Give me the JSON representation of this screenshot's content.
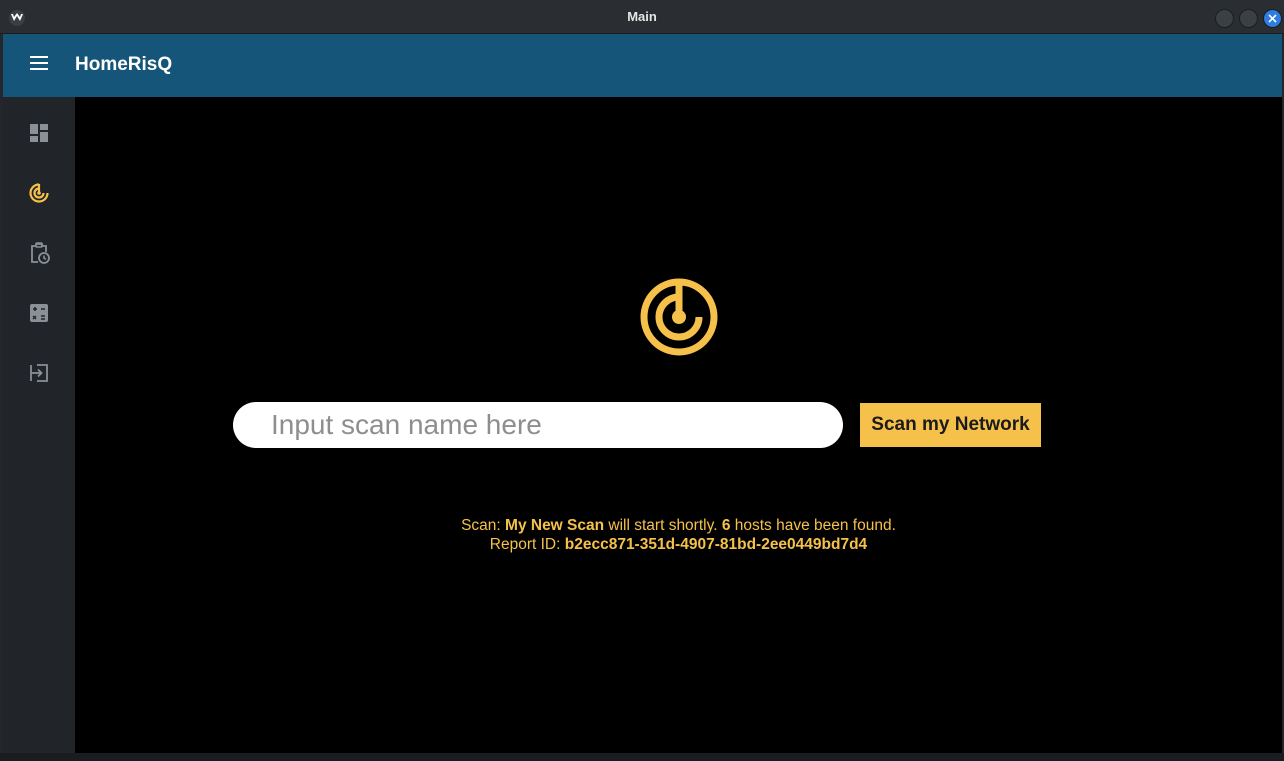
{
  "window": {
    "title": "Main"
  },
  "appbar": {
    "title": "HomeRisQ",
    "menu_icon": "hamburger-menu-icon"
  },
  "rail": {
    "items": [
      {
        "icon": "dashboard-icon",
        "active": false
      },
      {
        "icon": "radar-scan-icon",
        "active": true
      },
      {
        "icon": "clipboard-clock-icon",
        "active": false
      },
      {
        "icon": "calculator-icon",
        "active": false
      },
      {
        "icon": "logout-icon",
        "active": false
      }
    ]
  },
  "scan": {
    "input_placeholder": "Input scan name here",
    "input_value": "",
    "button_label": "Scan my Network"
  },
  "status": {
    "scan_prefix": "Scan:",
    "scan_name": "My New Scan",
    "scan_middle": "will start shortly.",
    "host_count": "6",
    "scan_suffix": "hosts have been found.",
    "report_prefix": "Report ID:",
    "report_id": "b2ecc871-351d-4907-81bd-2ee0449bd7d4"
  },
  "colors": {
    "accent": "#f6c14b",
    "appbar": "#16557a",
    "rail": "#212529",
    "content_bg": "#000000",
    "rail_icon": "#8a9096"
  }
}
